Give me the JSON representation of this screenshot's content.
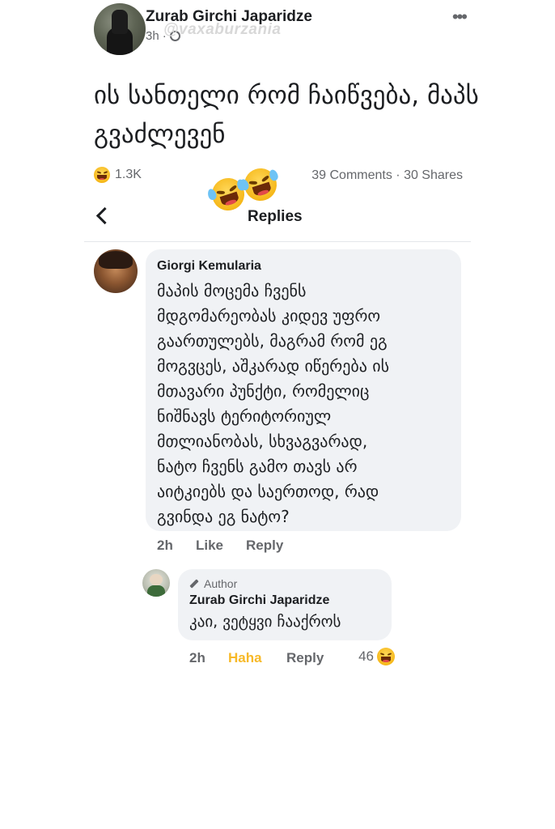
{
  "post": {
    "author": "Zurab Girchi Japaridze",
    "time": "3h",
    "time_separator": "·",
    "watermark": "@vaxaburzania",
    "more_label": "•••",
    "text": "ის სანთელი რომ ჩაიწვება, მაპს გვაძლევენ",
    "reactions_count": "1.3K",
    "comments_shares": "39 Comments · 30 Shares"
  },
  "replies_header": {
    "title": "Replies"
  },
  "comment": {
    "author": "Giorgi Kemularia",
    "text": "მაპის მოცემა ჩვენს\nმდგომარეობას კიდევ უფრო\nგაართულებს, მაგრამ რომ ეგ\nმოგვცეს, აშკარად იწერება ის\nმთავარი პუნქტი, რომელიც\nნიშნავს ტერიტორიულ\nმთლიანობას, სხვაგვარად,\nნატო ჩვენს გამო თავს არ\nაიტკიებს და საერთოდ, რად\nგვინდა ეგ ნატო?",
    "time": "2h",
    "like_label": "Like",
    "reply_label": "Reply"
  },
  "reply": {
    "badge": "Author",
    "author": "Zurab Girchi Japaridze",
    "text": "კაი, ვეტყვი ჩააქროს",
    "time": "2h",
    "reaction_label": "Haha",
    "reply_label": "Reply",
    "reaction_count": "46"
  },
  "colors": {
    "haha": "#f7b928",
    "bubble": "#f0f2f5",
    "muted": "#65676b"
  }
}
